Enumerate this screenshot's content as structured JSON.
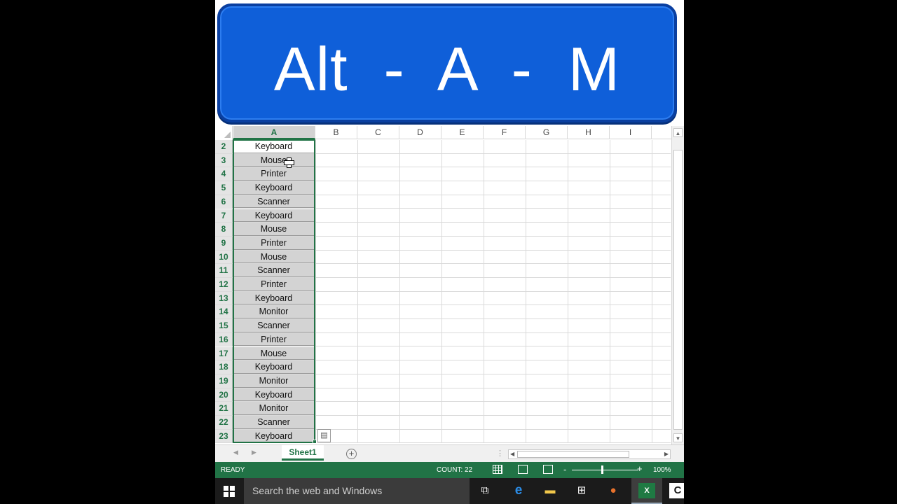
{
  "overlay": {
    "text": "Alt  -  A  -  M"
  },
  "spreadsheet": {
    "columns": [
      "A",
      "B",
      "C",
      "D",
      "E",
      "F",
      "G",
      "H",
      "I"
    ],
    "selected_column": "A",
    "rows": [
      {
        "num": "2",
        "a": "Keyboard"
      },
      {
        "num": "3",
        "a": "Mouse"
      },
      {
        "num": "4",
        "a": "Printer"
      },
      {
        "num": "5",
        "a": "Keyboard"
      },
      {
        "num": "6",
        "a": "Scanner"
      },
      {
        "num": "7",
        "a": "Keyboard"
      },
      {
        "num": "8",
        "a": "Mouse"
      },
      {
        "num": "9",
        "a": "Printer"
      },
      {
        "num": "10",
        "a": "Mouse"
      },
      {
        "num": "11",
        "a": "Scanner"
      },
      {
        "num": "12",
        "a": "Printer"
      },
      {
        "num": "13",
        "a": "Keyboard"
      },
      {
        "num": "14",
        "a": "Monitor"
      },
      {
        "num": "15",
        "a": "Scanner"
      },
      {
        "num": "16",
        "a": "Printer"
      },
      {
        "num": "17",
        "a": "Mouse"
      },
      {
        "num": "18",
        "a": "Keyboard"
      },
      {
        "num": "19",
        "a": "Monitor"
      },
      {
        "num": "20",
        "a": "Keyboard"
      },
      {
        "num": "21",
        "a": "Monitor"
      },
      {
        "num": "22",
        "a": "Scanner"
      },
      {
        "num": "23",
        "a": "Keyboard"
      }
    ]
  },
  "sheet_tabs": {
    "active": "Sheet1",
    "add_icon": "plus-circle-icon"
  },
  "status_bar": {
    "ready": "READY",
    "count": "COUNT: 22",
    "zoom": "100%",
    "zoom_minus": "-",
    "zoom_plus": "+"
  },
  "taskbar": {
    "search_placeholder": "Search the web and Windows"
  },
  "colors": {
    "excel_green": "#217346",
    "banner_blue": "#0f5fd9",
    "taskbar": "#1b1b1b"
  }
}
